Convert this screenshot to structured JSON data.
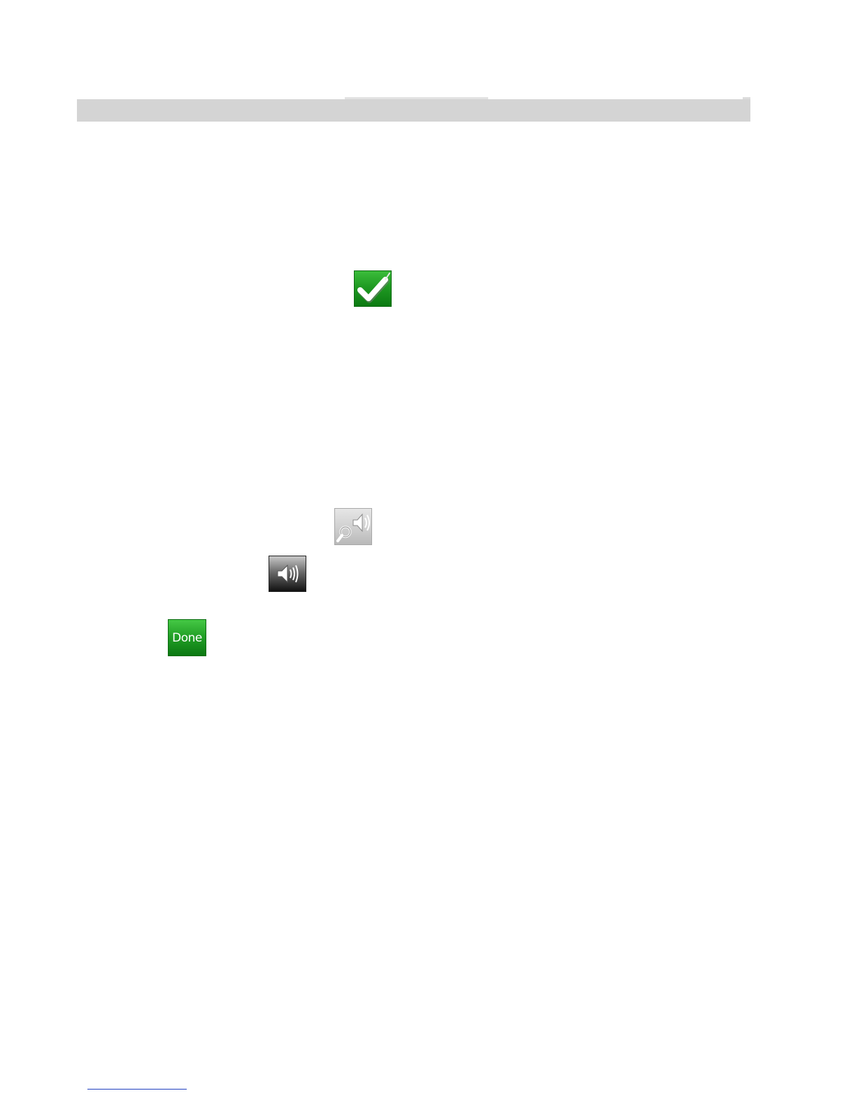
{
  "header": {
    "bar_color": "#d4d4d4"
  },
  "buttons": {
    "check": {
      "icon": "checkmark-icon",
      "color": "#1f9a22"
    },
    "voice_search": {
      "icon": "magnifier-speaker-icon",
      "color": "#cfcfcf"
    },
    "speaker": {
      "icon": "speaker-icon",
      "color": "#111111"
    },
    "done": {
      "label": "Done",
      "color": "#23a127"
    }
  },
  "footnote": {
    "rule_color": "#1f3fbf"
  }
}
